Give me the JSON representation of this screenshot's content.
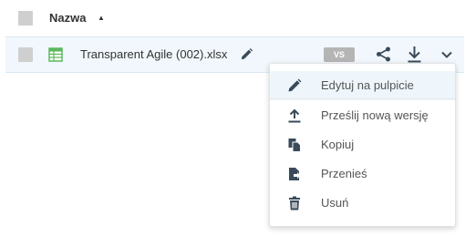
{
  "header": {
    "column_label": "Nazwa",
    "sort_indicator": "▲"
  },
  "file_row": {
    "icon": "xlsx-spreadsheet-icon",
    "file_name": "Transparent Agile (002).xlsx",
    "version_badge": "VS",
    "actions": [
      "edit-icon",
      "share-icon",
      "download-icon",
      "chevron-down-icon"
    ]
  },
  "menu": {
    "items": [
      {
        "label": "Edytuj na pulpicie",
        "icon": "pencil-icon"
      },
      {
        "label": "Prześlij nową wersję",
        "icon": "upload-icon"
      },
      {
        "label": "Kopiuj",
        "icon": "copy-icon"
      },
      {
        "label": "Przenieś",
        "icon": "move-icon"
      },
      {
        "label": "Usuń",
        "icon": "trash-icon"
      }
    ]
  },
  "colors": {
    "row_highlight": "#f1f7fc",
    "excel_green": "#5cb85c",
    "icon_dark": "#3a4a5a",
    "badge": "#b5b5b5"
  }
}
